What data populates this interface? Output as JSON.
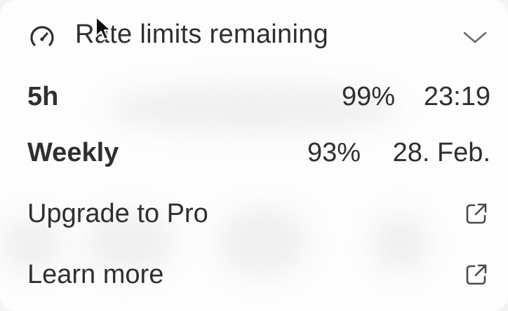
{
  "header": {
    "title": "Rate limits remaining",
    "icon": "gauge-icon",
    "toggle_icon": "chevron-down-icon"
  },
  "limits": [
    {
      "label": "5h",
      "percent": "99%",
      "reset": "23:19"
    },
    {
      "label": "Weekly",
      "percent": "93%",
      "reset": "28. Feb."
    }
  ],
  "links": [
    {
      "label": "Upgrade to Pro",
      "icon": "external-link-icon"
    },
    {
      "label": "Learn more",
      "icon": "external-link-icon"
    }
  ],
  "colors": {
    "text": "#2f2f2f",
    "background": "#fdfdfd"
  }
}
